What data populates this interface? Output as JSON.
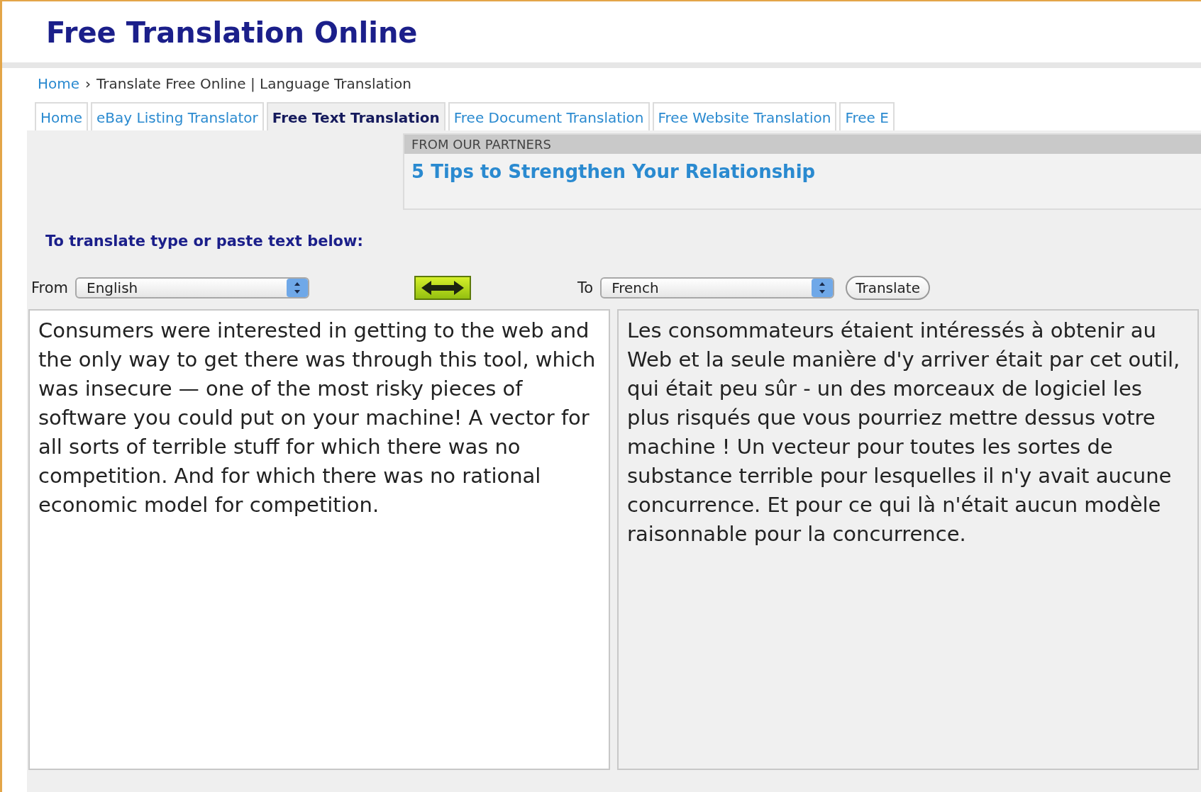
{
  "site_title": "Free Translation Online",
  "breadcrumb": {
    "home": "Home",
    "separator": "›",
    "rest": "Translate Free Online | Language Translation"
  },
  "tabs": [
    {
      "label": "Home",
      "selected": false
    },
    {
      "label": "eBay Listing Translator",
      "selected": false
    },
    {
      "label": "Free Text Translation",
      "selected": true
    },
    {
      "label": "Free Document Translation",
      "selected": false
    },
    {
      "label": "Free Website Translation",
      "selected": false
    },
    {
      "label": "Free E",
      "selected": false
    }
  ],
  "partners": {
    "heading": "FROM OUR PARTNERS",
    "link": "5 Tips to Strengthen Your Relationship"
  },
  "instructions": "To translate type or paste text below:",
  "from": {
    "label": "From",
    "value": "English"
  },
  "to": {
    "label": "To",
    "value": "French"
  },
  "translate_button": "Translate",
  "source_text": "Consumers were interested in getting to the web and the only way to get there was through this tool, which was insecure — one of the most risky pieces of software you could put on your machine! A vector for all sorts of terrible stuff for which there was no competition. And for which there was no rational economic model for competition.",
  "translated_text": "Les consommateurs étaient intéressés à obtenir au Web et la seule manière d'y arriver était par cet outil, qui était peu sûr - un des morceaux de logiciel les plus risqués que vous pourriez mettre dessus votre machine ! Un vecteur pour toutes les sortes de substance terrible pour lesquelles il n'y avait aucune concurrence. Et pour ce qui là n'était aucun modèle raisonnable pour la concurrence."
}
